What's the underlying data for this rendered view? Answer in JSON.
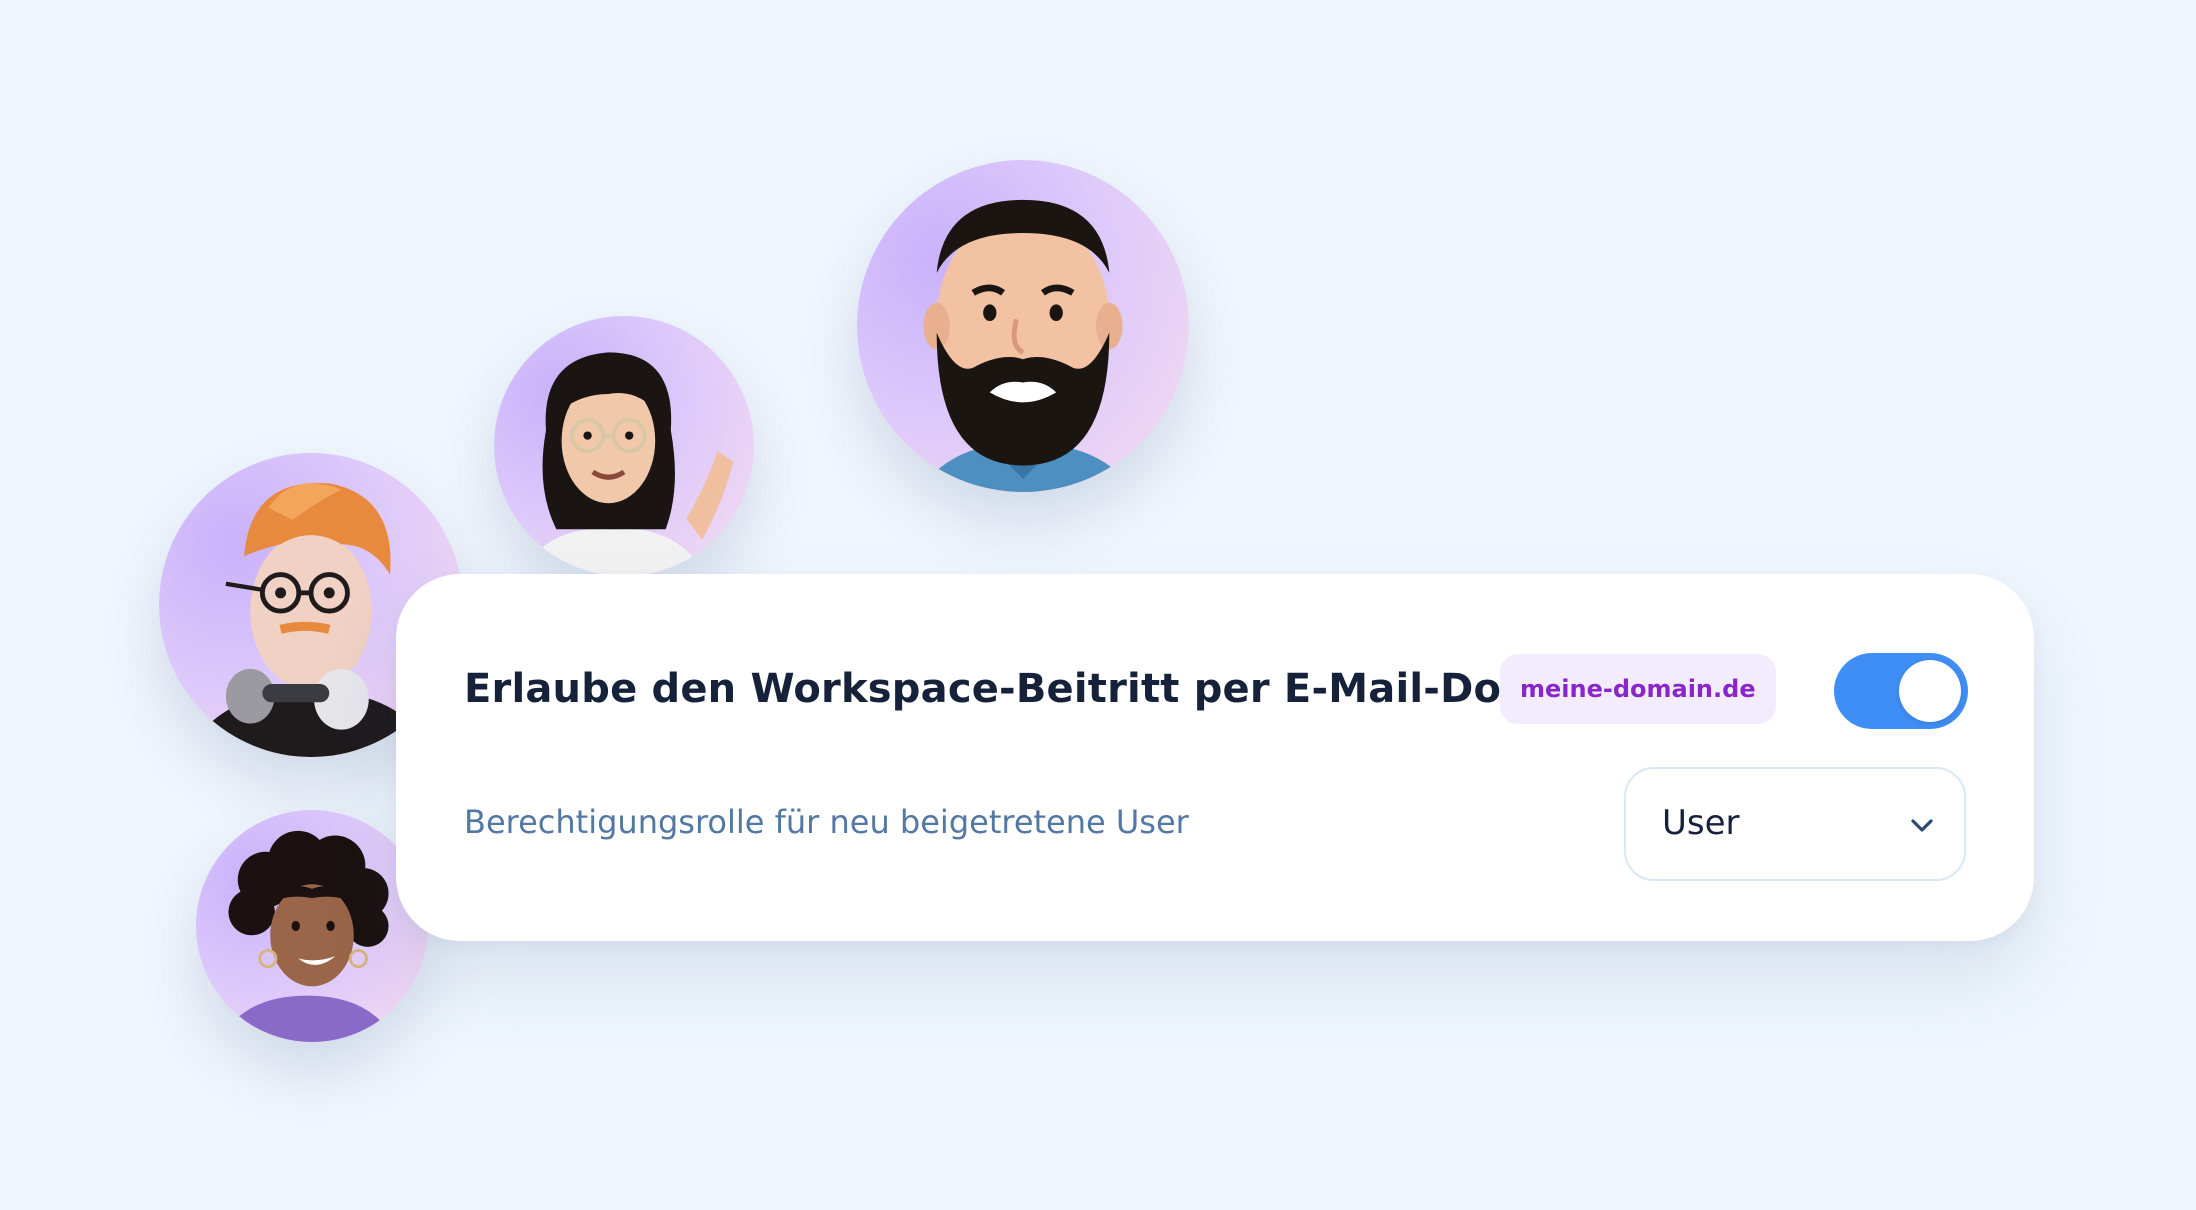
{
  "card": {
    "title": "Erlaube den Workspace-Beitritt per E-Mail-Domain",
    "domain_badge": "meine-domain.de",
    "toggle_enabled": true,
    "role_label": "Berechtigungsrolle für neu beigetretene User",
    "role_select_value": "User"
  },
  "colors": {
    "background": "#eff6fd",
    "toggle_on": "#3f8ef5",
    "badge_text": "#8a26c9",
    "badge_bg": "#f3ecfd",
    "title_text": "#16213a",
    "label_text": "#5378a4"
  },
  "icons": {
    "select": "chevron-down-icon"
  },
  "avatars": [
    {
      "name": "avatar-bearded-man"
    },
    {
      "name": "avatar-woman-glasses"
    },
    {
      "name": "avatar-ginger-man-headphones"
    },
    {
      "name": "avatar-curly-hair-woman"
    }
  ]
}
